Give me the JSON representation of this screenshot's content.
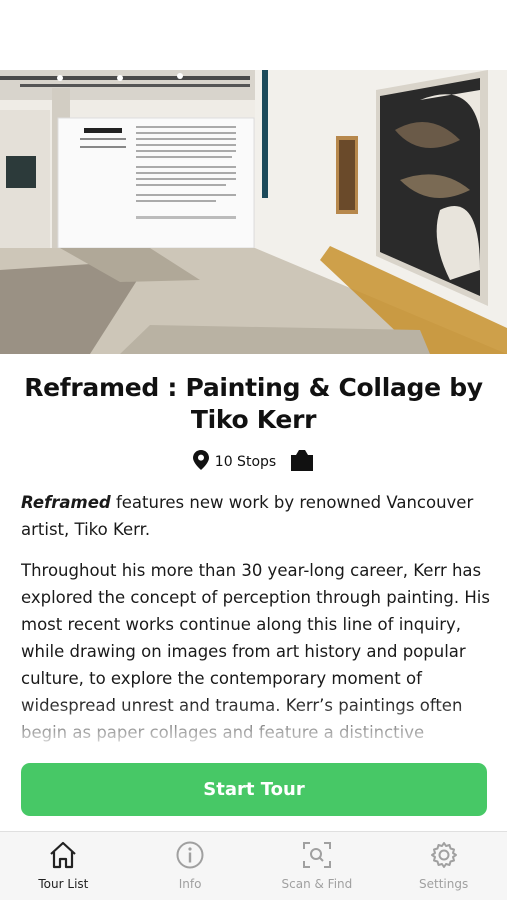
{
  "tour": {
    "title": "Reframed : Painting & Collage by Tiko Kerr",
    "stops": "10 Stops",
    "intro_emphasis": "Reframed",
    "intro_rest": " features new work by renowned Vancouver artist, Tiko Kerr.",
    "body": "Throughout his more than 30 year-long career, Kerr has explored the concept of perception through painting. His most recent works continue along this line of inquiry, while drawing on images from art history and popular culture, to explore the contemporary moment of widespread unrest and trauma. Kerr’s paintings often begin as paper collages and feature a distinctive layering of images"
  },
  "actions": {
    "start_tour": "Start Tour"
  },
  "tabs": [
    {
      "label": "Tour List",
      "icon": "home-icon",
      "active": true
    },
    {
      "label": "Info",
      "icon": "info-icon",
      "active": false
    },
    {
      "label": "Scan & Find",
      "icon": "scan-icon",
      "active": false
    },
    {
      "label": "Settings",
      "icon": "gear-icon",
      "active": false
    }
  ],
  "colors": {
    "accent": "#47c866",
    "tab_active": "#222222",
    "tab_inactive": "#a0a0a0"
  }
}
